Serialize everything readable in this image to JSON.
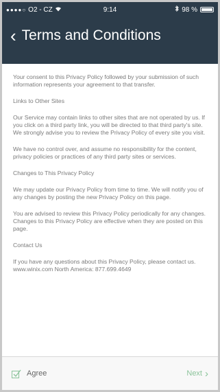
{
  "status_bar": {
    "signal": "●●●●○",
    "carrier": "O2 - CZ",
    "wifi_icon": "wifi-icon",
    "time": "9:14",
    "battery_percent": "98 %"
  },
  "nav": {
    "back_icon": "‹",
    "title": "Terms and Conditions"
  },
  "content": {
    "paragraphs": [
      "Your consent to this Privacy Policy followed by your submission of such information represents your agreement to that transfer.",
      "Links to Other Sites",
      "Our Service may contain links to other sites that are not operated by us. If you click on a third party link, you will be directed to that third party's site. We strongly advise you to review the Privacy Policy of every site you visit.",
      "We have no control over, and assume no responsibility for the content, privacy policies or practices of any third party sites or services.",
      "Changes to This Privacy Policy",
      "We may update our Privacy Policy from time to time. We will notify you of any changes by posting the new Privacy Policy on this page.",
      "You are advised to review this Privacy Policy periodically for any changes. Changes to this Privacy Policy are effective when they are posted on this page.",
      "Contact Us",
      "If you have any questions about this Privacy Policy, please contact us. www.winix.com North America: 877.699.4649"
    ]
  },
  "footer": {
    "agree_label": "Agree",
    "next_label": "Next",
    "next_icon": "›"
  },
  "colors": {
    "header_bg": "#2c3c4a",
    "accent_green": "#8bc39a"
  }
}
